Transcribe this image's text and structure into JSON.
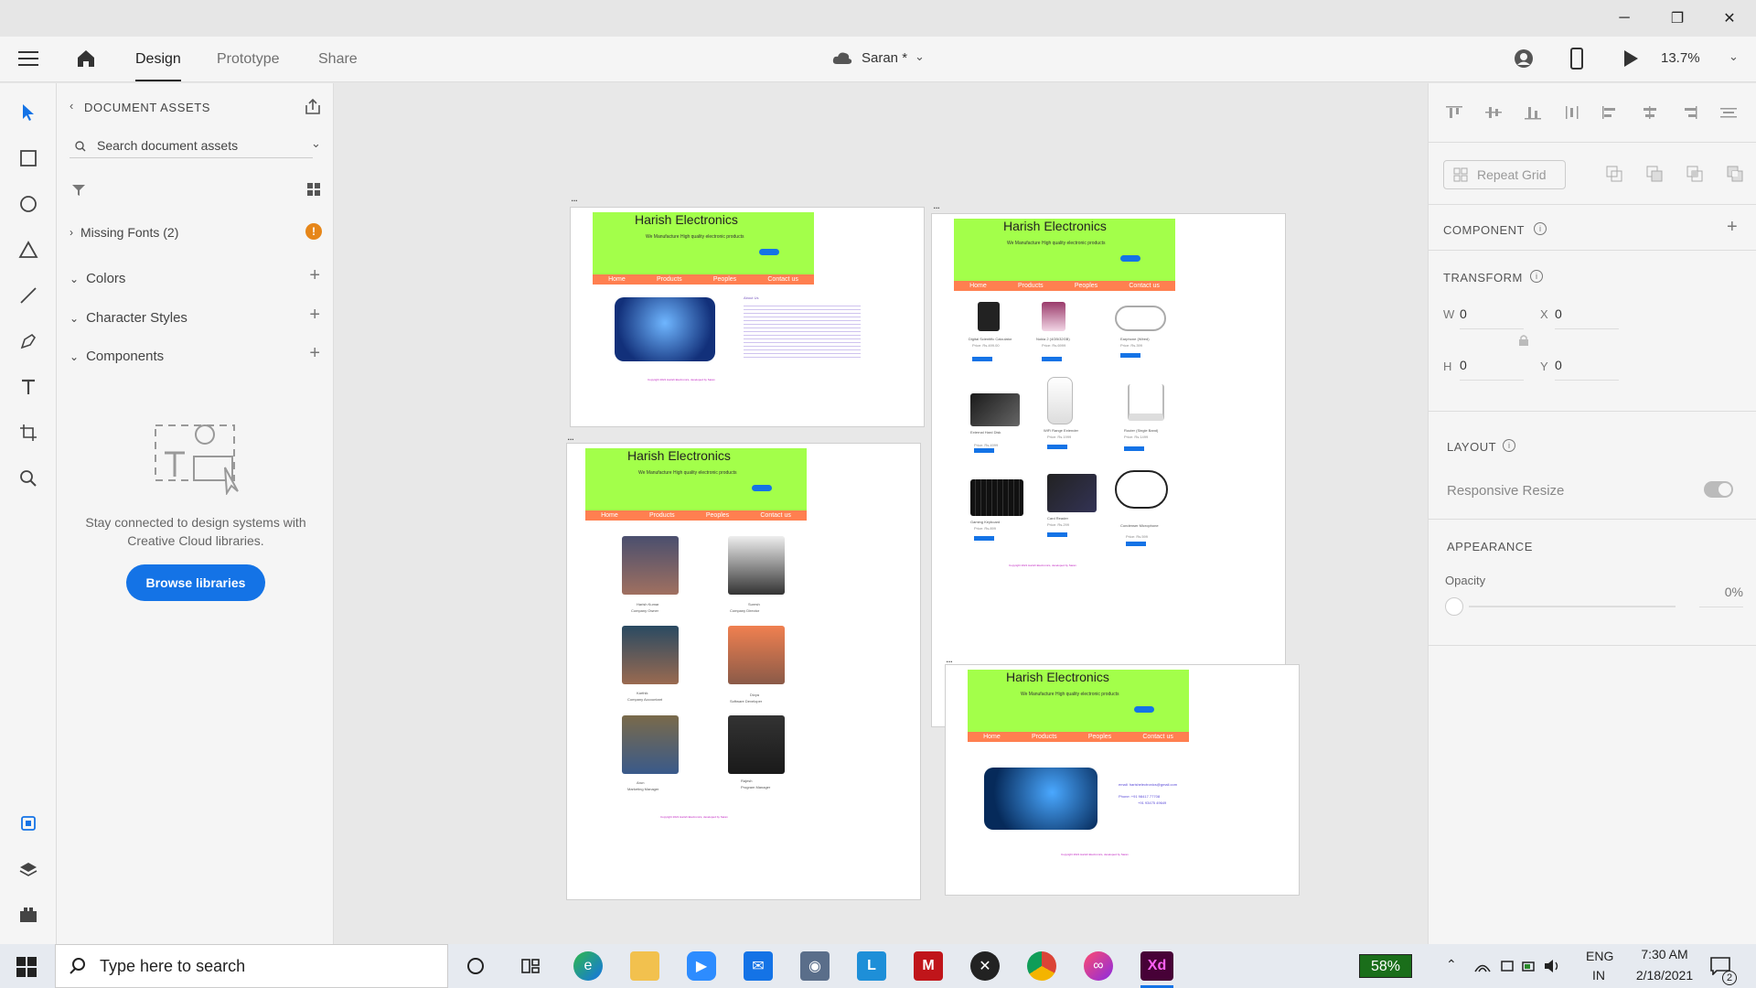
{
  "window": {
    "minimize": "─",
    "maximize": "❐",
    "close": "✕"
  },
  "appbar": {
    "tabs": [
      {
        "label": "Design"
      },
      {
        "label": "Prototype"
      },
      {
        "label": "Share"
      }
    ],
    "doc_name": "Saran *",
    "zoom": "13.7%"
  },
  "assets": {
    "title": "DOCUMENT ASSETS",
    "search_placeholder": "Search document assets",
    "missing_fonts": "Missing Fonts (2)",
    "sections": [
      {
        "label": "Colors"
      },
      {
        "label": "Character Styles"
      },
      {
        "label": "Components"
      }
    ],
    "empty_text": "Stay connected to design systems with Creative Cloud libraries.",
    "browse_label": "Browse libraries"
  },
  "artboards": {
    "dots": "...",
    "brand": "Harish Electronics",
    "tagline": "We Manufacture High quality electronic products",
    "btn": "Learn more",
    "nav": [
      "Home",
      "Products",
      "Peoples",
      "Contact us"
    ],
    "footer": "Copyright 2021 Harish Electronics, developed by Saran",
    "about_heading": "About Us",
    "products": [
      {
        "name": "Digital Scientific Calculator",
        "price": "Price: Rs.499.00"
      },
      {
        "name": "Nokia 2 (4GB/32GB)",
        "price": "Price: Rs.6999"
      },
      {
        "name": "Earphone (Wired)",
        "price": "Price: Rs.399"
      },
      {
        "name": "External Hard Disk",
        "price": "Price: Rs.4999"
      },
      {
        "name": "WiFi Range Extender",
        "price": "Price: Rs.1999"
      },
      {
        "name": "Router (Single Band)",
        "price": "Price: Rs.1499"
      },
      {
        "name": "Gaming Keyboard",
        "price": "Price: Rs.899"
      },
      {
        "name": "Card Reader",
        "price": "Price: Rs.299"
      },
      {
        "name": "Condenser Microphone",
        "price": "Price: Rs.599"
      }
    ],
    "buy_label": "Buy Now",
    "people": [
      {
        "name": "Harish Kumar",
        "role": "Company Owner"
      },
      {
        "name": "Suresh",
        "role": "Company Director"
      },
      {
        "name": "Karthik",
        "role": "Company Accountant"
      },
      {
        "name": "Divya",
        "role": "Software Developer"
      },
      {
        "name": "Arun",
        "role": "Marketing Manager"
      },
      {
        "name": "Rajesh",
        "role": "Program Manager"
      }
    ],
    "contact_email": "email: harishelectronics@gmail.com",
    "contact_phone1": "Phone: +91 98417 77708",
    "contact_phone2": "+91 93475 49649"
  },
  "props": {
    "repeat_grid": "Repeat Grid",
    "component": "COMPONENT",
    "transform": "TRANSFORM",
    "w_label": "W",
    "w": "0",
    "x_label": "X",
    "x": "0",
    "h_label": "H",
    "h": "0",
    "y_label": "Y",
    "y": "0",
    "layout": "LAYOUT",
    "responsive": "Responsive Resize",
    "appearance": "APPEARANCE",
    "opacity_label": "Opacity",
    "opacity": "0%"
  },
  "taskbar": {
    "search_placeholder": "Type here to search",
    "battery": "58%",
    "lang1": "ENG",
    "lang2": "IN",
    "time": "7:30 AM",
    "date": "2/18/2021",
    "notif_count": "2"
  },
  "colors": {
    "accent": "#1473e6",
    "hero": "#a3ff4a",
    "nav": "#ff7f50"
  }
}
